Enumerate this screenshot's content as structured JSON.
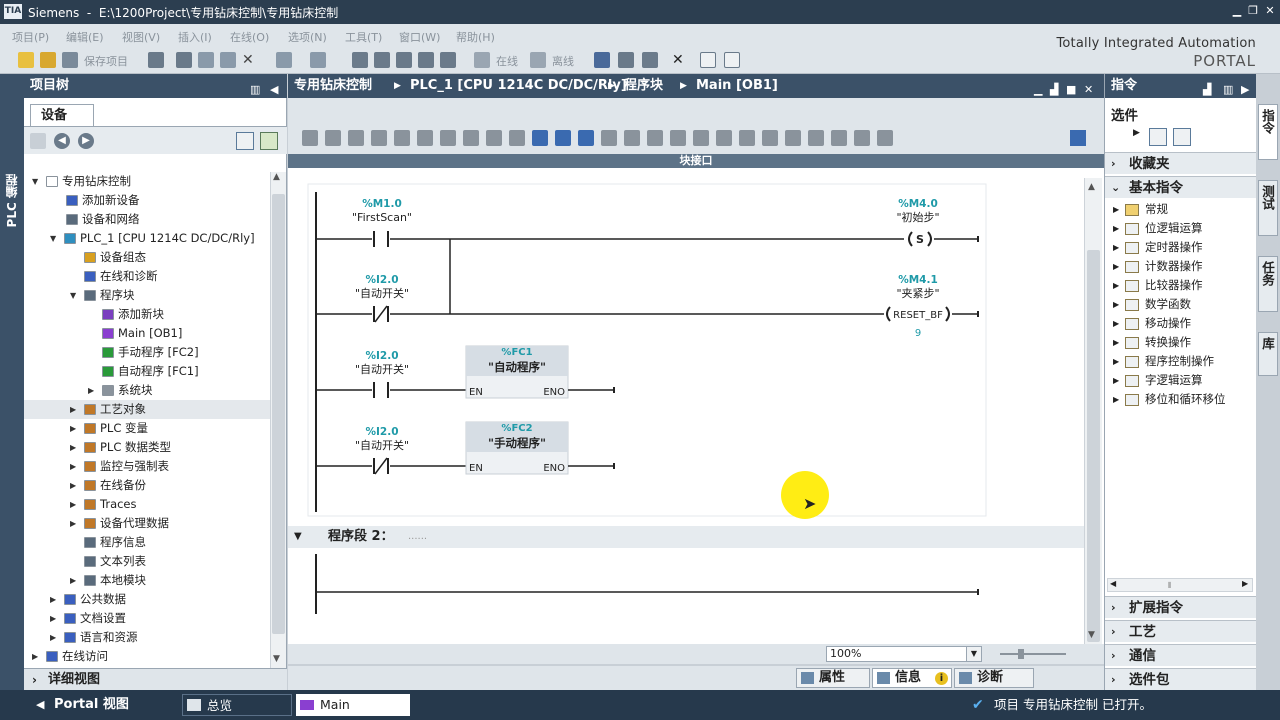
{
  "window": {
    "app": "Siemens",
    "path": "E:\\1200Project\\专用钻床控制\\专用钻床控制",
    "logo_text": "TIA"
  },
  "menu": [
    "项目(P)",
    "编辑(E)",
    "视图(V)",
    "插入(I)",
    "在线(O)",
    "选项(N)",
    "工具(T)",
    "窗口(W)",
    "帮助(H)"
  ],
  "toolbar": {
    "save_label": "保存项目",
    "online_label": "在线",
    "offline_label": "离线"
  },
  "brand": {
    "line1": "Totally Integrated Automation",
    "line2": "PORTAL"
  },
  "left_strip": {
    "label": "PLC 编程"
  },
  "project_tree": {
    "title": "项目树",
    "tab": "设备",
    "items": [
      {
        "label": "专用钻床控制",
        "arrow": "▼",
        "icon": "project-icon",
        "color": "#ffffff"
      },
      {
        "label": "添加新设备",
        "arrow": "",
        "icon": "add-device-icon",
        "color": "#3a5fbf"
      },
      {
        "label": "设备和网络",
        "arrow": "",
        "icon": "network-icon",
        "color": "#5a6b7c"
      },
      {
        "label": "PLC_1 [CPU 1214C DC/DC/Rly]",
        "arrow": "▼",
        "icon": "plc-icon",
        "color": "#2f8fbf"
      },
      {
        "label": "设备组态",
        "arrow": "",
        "icon": "device-config-icon",
        "color": "#d8a020"
      },
      {
        "label": "在线和诊断",
        "arrow": "",
        "icon": "diagnostics-icon",
        "color": "#3a5fbf"
      },
      {
        "label": "程序块",
        "arrow": "▼",
        "icon": "folder-icon",
        "color": "#5a6b7c"
      },
      {
        "label": "添加新块",
        "arrow": "",
        "icon": "add-block-icon",
        "color": "#7a3fbf"
      },
      {
        "label": "Main [OB1]",
        "arrow": "",
        "icon": "ob-icon",
        "color": "#8a3fd0"
      },
      {
        "label": "手动程序 [FC2]",
        "arrow": "",
        "icon": "fc-icon",
        "color": "#2a9a3a"
      },
      {
        "label": "自动程序 [FC1]",
        "arrow": "",
        "icon": "fc-icon",
        "color": "#2a9a3a"
      },
      {
        "label": "系统块",
        "arrow": "▶",
        "icon": "folder-icon",
        "color": "#8a939c"
      },
      {
        "label": "工艺对象",
        "arrow": "▶",
        "icon": "folder-icon",
        "color": "#c07828"
      },
      {
        "label": "PLC 变量",
        "arrow": "▶",
        "icon": "tags-icon",
        "color": "#c07828"
      },
      {
        "label": "PLC 数据类型",
        "arrow": "▶",
        "icon": "datatype-icon",
        "color": "#c07828"
      },
      {
        "label": "监控与强制表",
        "arrow": "▶",
        "icon": "watch-icon",
        "color": "#c07828"
      },
      {
        "label": "在线备份",
        "arrow": "▶",
        "icon": "backup-icon",
        "color": "#c07828"
      },
      {
        "label": "Traces",
        "arrow": "▶",
        "icon": "trace-icon",
        "color": "#c07828"
      },
      {
        "label": "设备代理数据",
        "arrow": "▶",
        "icon": "proxy-icon",
        "color": "#c07828"
      },
      {
        "label": "程序信息",
        "arrow": "",
        "icon": "info-icon",
        "color": "#5a6b7c"
      },
      {
        "label": "文本列表",
        "arrow": "",
        "icon": "textlist-icon",
        "color": "#5a6b7c"
      },
      {
        "label": "本地模块",
        "arrow": "▶",
        "icon": "module-icon",
        "color": "#5a6b7c"
      },
      {
        "label": "公共数据",
        "arrow": "▶",
        "icon": "common-data-icon",
        "color": "#3a5fbf"
      },
      {
        "label": "文档设置",
        "arrow": "▶",
        "icon": "doc-icon",
        "color": "#3a5fbf"
      },
      {
        "label": "语言和资源",
        "arrow": "▶",
        "icon": "language-icon",
        "color": "#3a5fbf"
      },
      {
        "label": "在线访问",
        "arrow": "▶",
        "icon": "online-access-icon",
        "color": "#3a5fbf"
      }
    ]
  },
  "detail_view": {
    "label": "详细视图"
  },
  "editor": {
    "breadcrumb": [
      "专用钻床控制",
      "PLC_1 [CPU 1214C DC/DC/Rly]",
      "程序块",
      "Main [OB1]"
    ],
    "block_interface": "块接口",
    "network2_title": "程序段 2：",
    "network2_comment": "......",
    "zoom": "100%"
  },
  "ladder": {
    "rung1_contact_addr": "%M1.0",
    "rung1_contact_name": "\"FirstScan\"",
    "rung1_coil_addr": "%M4.0",
    "rung1_coil_name": "\"初始步\"",
    "rung1_coil_type": "S",
    "rung2_contact_addr": "%I2.0",
    "rung2_contact_name": "\"自动开关\"",
    "rung2_coil_addr": "%M4.1",
    "rung2_coil_name": "\"夹紧步\"",
    "rung2_coil_type": "RESET_BF",
    "rung2_coil_param": "9",
    "rung3_contact_addr": "%I2.0",
    "rung3_contact_name": "\"自动开关\"",
    "rung3_box_addr": "%FC1",
    "rung3_box_name": "\"自动程序\"",
    "rung4_contact_addr": "%I2.0",
    "rung4_contact_name": "\"自动开关\"",
    "rung4_box_addr": "%FC2",
    "rung4_box_name": "\"手动程序\"",
    "box_en": "EN",
    "box_eno": "ENO"
  },
  "inspector_tabs": {
    "properties": "属性",
    "info": "信息",
    "diagnostics": "诊断"
  },
  "instructions": {
    "title": "指令",
    "options_label": "选件",
    "favorites": "收藏夹",
    "basic": "基本指令",
    "basic_items": [
      "常规",
      "位逻辑运算",
      "定时器操作",
      "计数器操作",
      "比较器操作",
      "数学函数",
      "移动操作",
      "转换操作",
      "程序控制操作",
      "字逻辑运算",
      "移位和循环移位"
    ],
    "extended": "扩展指令",
    "technology": "工艺",
    "communication": "通信",
    "optional_packages": "选件包"
  },
  "right_tabs": [
    "指令",
    "测试",
    "任务",
    "库"
  ],
  "taskbar": {
    "portal_view": "Portal 视图",
    "overview": "总览",
    "main_tab": "Main",
    "status": "项目 专用钻床控制 已打开。"
  }
}
